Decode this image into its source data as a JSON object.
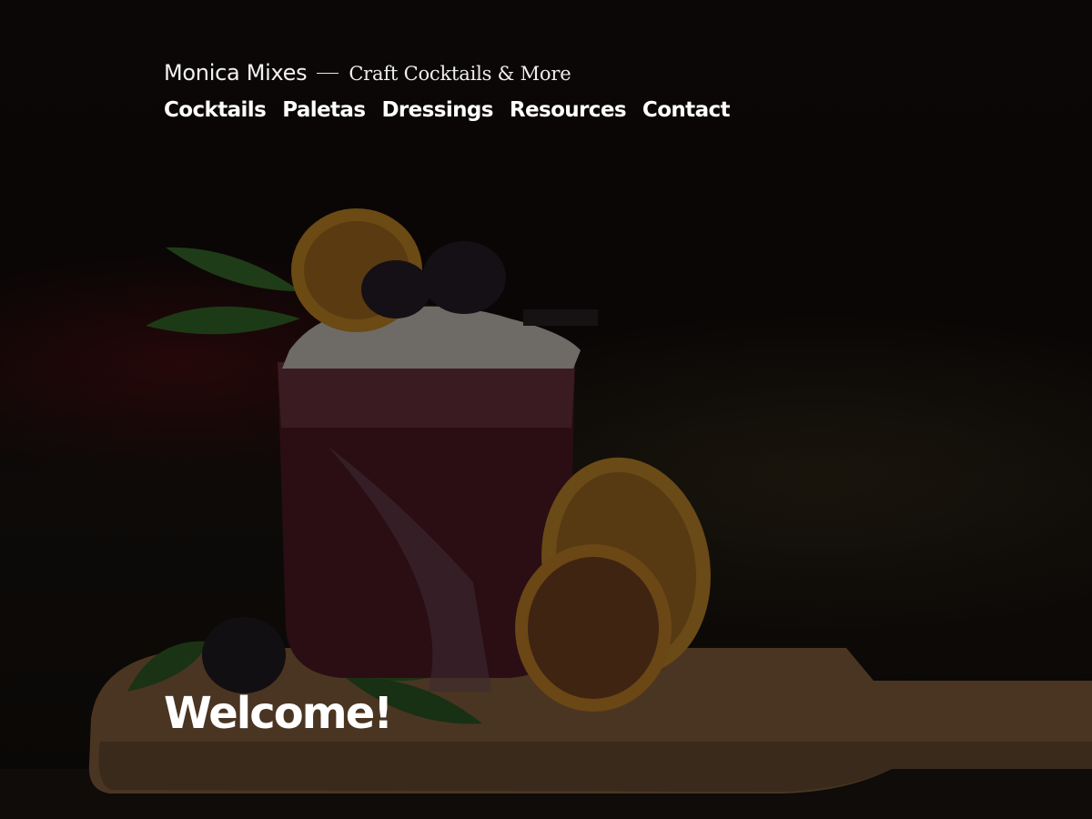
{
  "site": {
    "title": "Monica Mixes",
    "tagline": "Craft Cocktails & More"
  },
  "nav": {
    "items": [
      {
        "label": "Cocktails"
      },
      {
        "label": "Paletas"
      },
      {
        "label": "Dressings"
      },
      {
        "label": "Resources"
      },
      {
        "label": "Contact"
      }
    ]
  },
  "hero": {
    "heading": "Welcome!"
  },
  "colors": {
    "text": "#ffffff",
    "overlay": "#050404"
  }
}
